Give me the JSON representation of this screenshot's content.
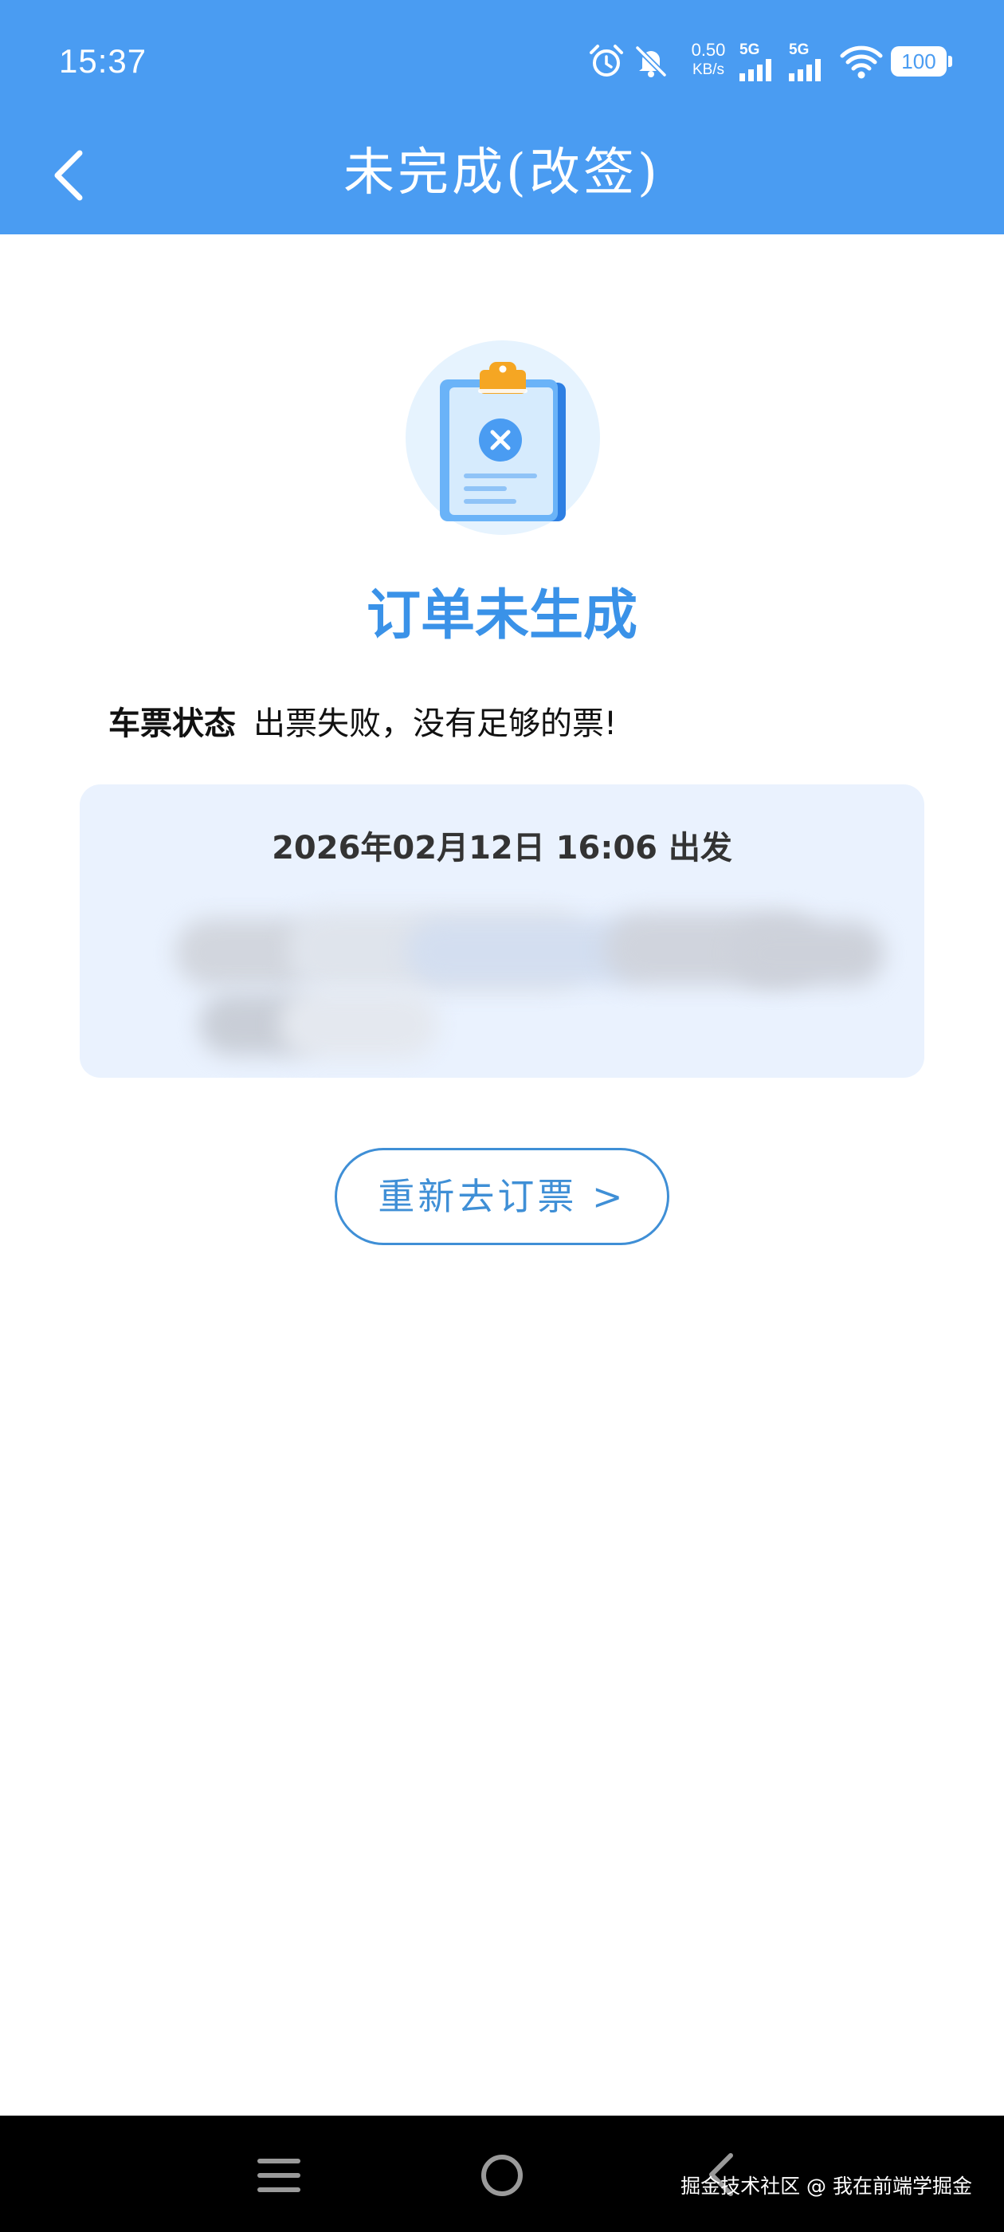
{
  "status_bar": {
    "time": "15:37",
    "net_speed_value": "0.50",
    "net_speed_unit": "KB/s",
    "sim1_label": "5G",
    "sim2_label": "5G",
    "battery": "100",
    "icons": [
      "alarm-icon",
      "bell-off-icon",
      "signal-icon",
      "signal-icon",
      "wifi-icon",
      "battery-icon"
    ]
  },
  "nav": {
    "title": "未完成(改签)",
    "back_icon": "chevron-left-icon"
  },
  "result": {
    "icon": "clipboard-failed-icon",
    "title": "订单未生成",
    "status_label": "车票状态",
    "status_value": "出票失败，没有足够的票!"
  },
  "trip": {
    "depart_text": "2026年02月12日 16:06 出发"
  },
  "actions": {
    "rebook_label": "重新去订票 >"
  },
  "system_nav": {
    "icons": [
      "menu-icon",
      "home-icon",
      "back-icon"
    ],
    "watermark": "掘金技术社区 @ 我在前端学掘金"
  },
  "colors": {
    "primary": "#4a9cf2",
    "title_blue": "#3a92e8",
    "card_bg": "#eaf2fe",
    "button_border": "#3f8fd6"
  }
}
